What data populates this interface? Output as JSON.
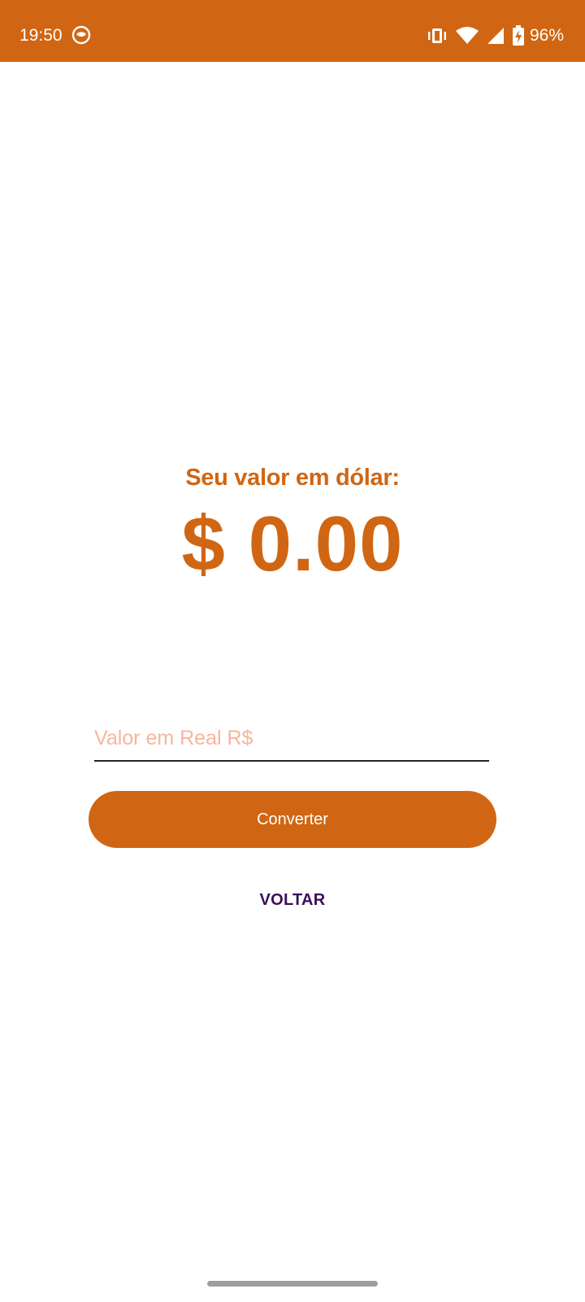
{
  "status_bar": {
    "time": "19:50",
    "battery_percent": "96%",
    "icons": [
      "app-notification-icon",
      "vibrate-icon",
      "wifi-icon",
      "signal-icon",
      "battery-charging-icon"
    ]
  },
  "result": {
    "label": "Seu valor em dólar:",
    "value": "$ 0.00"
  },
  "input": {
    "placeholder": "Valor em Real R$",
    "value": ""
  },
  "buttons": {
    "convert_label": "Converter",
    "back_label": "VOLTAR"
  },
  "colors": {
    "primary": "#D06613",
    "placeholder": "#F8B59A",
    "back_text": "#3B0F5C",
    "background": "#FFFFFF"
  }
}
